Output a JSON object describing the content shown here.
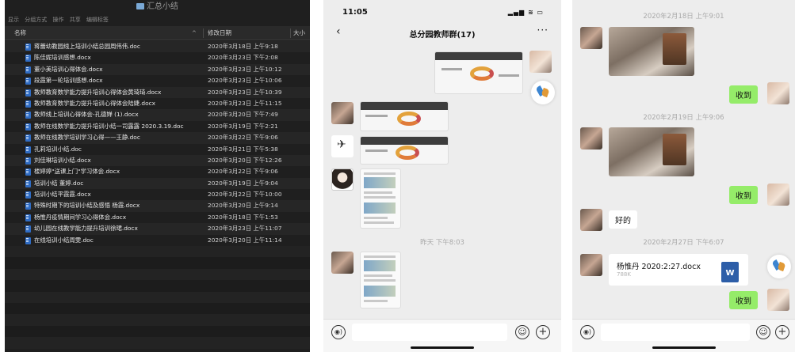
{
  "finder": {
    "window_title": "汇总小结",
    "toolbar_items": [
      "显示",
      "分组方式",
      "操作",
      "共享",
      "编辑标签"
    ],
    "columns": {
      "name": "名称",
      "date": "修改日期",
      "size": "大小"
    },
    "files": [
      {
        "name": "蒋蕾幼教园线上培训小结总园周伟伟.doc",
        "date": "2020年3月18日 上午9:18"
      },
      {
        "name": "陈佳妮培训感想.docx",
        "date": "2020年3月23日 下午2:08"
      },
      {
        "name": "董小美培训心得体会.docx",
        "date": "2020年3月23日 上午10:12"
      },
      {
        "name": "段霞第一轮培训感想.docx",
        "date": "2020年3月23日 上午10:06"
      },
      {
        "name": "教师教育数学能力提升培训心得体会黄琦琦.docx",
        "date": "2020年3月23日 上午10:39"
      },
      {
        "name": "教师教育数学能力提升培训心得体会陆婕.docx",
        "date": "2020年3月23日 上午11:15"
      },
      {
        "name": "教师线上培训心得体会-孔德婵 (1).docx",
        "date": "2020年3月20日 下午7:49"
      },
      {
        "name": "教师在线数学能力提升培训小结一司露露 2020.3.19.doc",
        "date": "2020年3月19日 下午2:21"
      },
      {
        "name": "教师在线教学培训学习心得——王静.doc",
        "date": "2020年3月22日 下午9:06"
      },
      {
        "name": "孔莉培训小结.doc",
        "date": "2020年3月21日 下午5:38"
      },
      {
        "name": "刘佳琳培训小结.docx",
        "date": "2020年3月20日 下午12:26"
      },
      {
        "name": "楼婷婷\"送课上门\"学习体会.docx",
        "date": "2020年3月22日 下午9:06"
      },
      {
        "name": "培训小结 董婷.doc",
        "date": "2020年3月19日 上午9:04"
      },
      {
        "name": "培训小结平霞霞.docx",
        "date": "2020年3月22日 下午10:00"
      },
      {
        "name": "特殊时期下的培训小结及感悟 杨霞.docx",
        "date": "2020年3月20日 上午9:14"
      },
      {
        "name": "杨惟丹疫情期间学习心得体会.docx",
        "date": "2020年3月18日 下午1:53"
      },
      {
        "name": "幼儿园在线教学能力提升培训徐珺.docx",
        "date": "2020年3月23日 上午11:07"
      },
      {
        "name": "在线培训小结周雯.doc",
        "date": "2020年3月20日 上午11:14"
      }
    ],
    "empty_rows": 9
  },
  "chat1": {
    "status_time": "11:05",
    "status_icons": "▂▄▆ ≋ ▭",
    "back_symbol": "‹",
    "title": "总分园教师群(17)",
    "more_symbol": "···",
    "time_separator": "昨天 下午8:03"
  },
  "chat2": {
    "time_sep_1": "2020年2月18日 上午9:01",
    "time_sep_2": "2020年2月19日 上午9:06",
    "time_sep_3": "2020年2月27日 下午6:07",
    "reply_received": "收到",
    "reply_ok": "好的",
    "file_name": "杨惟丹 2020:2:27.docx",
    "file_size": "788K",
    "file_badge": "W"
  },
  "input": {
    "voice_symbol": "◉)",
    "emoji_symbol": "☺",
    "plus_symbol": "+"
  },
  "colors": {
    "finder_bg": "#1f1f1f",
    "chat_bg": "#ededed",
    "bubble_green": "#95ec69",
    "doc_icon": "#2f6cc4"
  }
}
